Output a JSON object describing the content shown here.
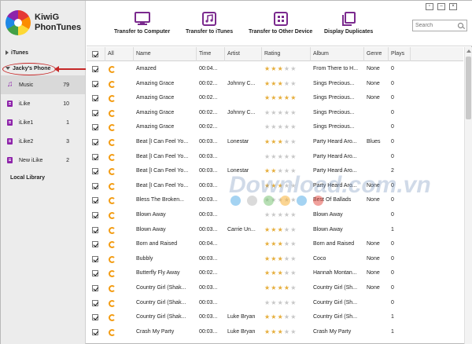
{
  "app": {
    "name_line1": "KiwiG",
    "name_line2": "PhonTunes"
  },
  "sidebar": {
    "itunes_label": "iTunes",
    "device_label": "Jacky's Phone",
    "items": [
      {
        "label": "Music",
        "count": "79",
        "icon": "music-note-icon"
      },
      {
        "label": "iLike",
        "count": "10",
        "icon": "playlist-icon"
      },
      {
        "label": "iLike1",
        "count": "1",
        "icon": "playlist-icon"
      },
      {
        "label": "iLike2",
        "count": "3",
        "icon": "playlist-icon"
      },
      {
        "label": "New iLike",
        "count": "2",
        "icon": "playlist-icon"
      }
    ],
    "local_library_label": "Local Library"
  },
  "toolbar": {
    "transfer_computer": "Transfer to Computer",
    "transfer_itunes": "Transfer to iTunes",
    "transfer_other": "Transfer to Other Device",
    "display_duplicates": "Display Duplicates",
    "search_placeholder": "Search",
    "accent_color": "#7b2a8e"
  },
  "table": {
    "columns": [
      "All",
      "Name",
      "Time",
      "Artist",
      "Rating",
      "Album",
      "Genre",
      "Plays"
    ],
    "rows": [
      {
        "name": "Amazed",
        "time": "00:04...",
        "artist": "",
        "rating": 3,
        "album": "From There to H...",
        "genre": "None",
        "plays": "0"
      },
      {
        "name": "Amazing Grace",
        "time": "00:02...",
        "artist": "Johnny C...",
        "rating": 3,
        "album": "Sings Precious...",
        "genre": "None",
        "plays": "0"
      },
      {
        "name": "Amazing Grace",
        "time": "00:02...",
        "artist": "",
        "rating": 5,
        "album": "Sings Precious...",
        "genre": "None",
        "plays": "0"
      },
      {
        "name": "Amazing Grace",
        "time": "00:02...",
        "artist": "Johnny C...",
        "rating": 0,
        "album": "Sings Precious...",
        "genre": "",
        "plays": "0"
      },
      {
        "name": "Amazing Grace",
        "time": "00:02...",
        "artist": "",
        "rating": 0,
        "album": "Sings Precious...",
        "genre": "",
        "plays": "0"
      },
      {
        "name": "Beat [I Can Feel Yo...",
        "time": "00:03...",
        "artist": "Lonestar",
        "rating": 3,
        "album": "Party Heard Aro...",
        "genre": "Blues",
        "plays": "0"
      },
      {
        "name": "Beat [I Can Feel Yo...",
        "time": "00:03...",
        "artist": "",
        "rating": 0,
        "album": "Party Heard Aro...",
        "genre": "",
        "plays": "0"
      },
      {
        "name": "Beat [I Can Feel Yo...",
        "time": "00:03...",
        "artist": "Lonestar",
        "rating": 2,
        "album": "Party Heard Aro...",
        "genre": "",
        "plays": "2"
      },
      {
        "name": "Beat [I Can Feel Yo...",
        "time": "00:03...",
        "artist": "",
        "rating": 3,
        "album": "Party Heard Aro...",
        "genre": "None",
        "plays": "0"
      },
      {
        "name": "Bless The Broken...",
        "time": "00:03...",
        "artist": "",
        "rating": 0,
        "album": "Best Of Ballads",
        "genre": "None",
        "plays": "0"
      },
      {
        "name": "Blown Away",
        "time": "00:03...",
        "artist": "",
        "rating": 0,
        "album": "Blown Away",
        "genre": "",
        "plays": "0"
      },
      {
        "name": "Blown Away",
        "time": "00:03...",
        "artist": "Carrie Un...",
        "rating": 3,
        "album": "Blown Away",
        "genre": "",
        "plays": "1"
      },
      {
        "name": "Born and Raised",
        "time": "00:04...",
        "artist": "",
        "rating": 3,
        "album": "Born and Raised",
        "genre": "None",
        "plays": "0"
      },
      {
        "name": "Bubbly",
        "time": "00:03...",
        "artist": "",
        "rating": 3,
        "album": "Coco",
        "genre": "None",
        "plays": "0"
      },
      {
        "name": "Butterfly Fly Away",
        "time": "00:02...",
        "artist": "",
        "rating": 3,
        "album": "Hannah Montan...",
        "genre": "None",
        "plays": "0"
      },
      {
        "name": "Country Girl (Shak...",
        "time": "00:03...",
        "artist": "",
        "rating": 4,
        "album": "Country Girl (Sh...",
        "genre": "None",
        "plays": "0"
      },
      {
        "name": "Country Girl (Shak...",
        "time": "00:03...",
        "artist": "",
        "rating": 0,
        "album": "Country Girl (Sh...",
        "genre": "",
        "plays": "0"
      },
      {
        "name": "Country Girl (Shak...",
        "time": "00:03...",
        "artist": "Luke Bryan",
        "rating": 3,
        "album": "Country Girl (Sh...",
        "genre": "",
        "plays": "1"
      },
      {
        "name": "Crash My Party",
        "time": "00:03...",
        "artist": "Luke Bryan",
        "rating": 3,
        "album": "Crash My Party",
        "genre": "",
        "plays": "1"
      }
    ]
  },
  "watermark": {
    "text": "Download.com.vn"
  }
}
